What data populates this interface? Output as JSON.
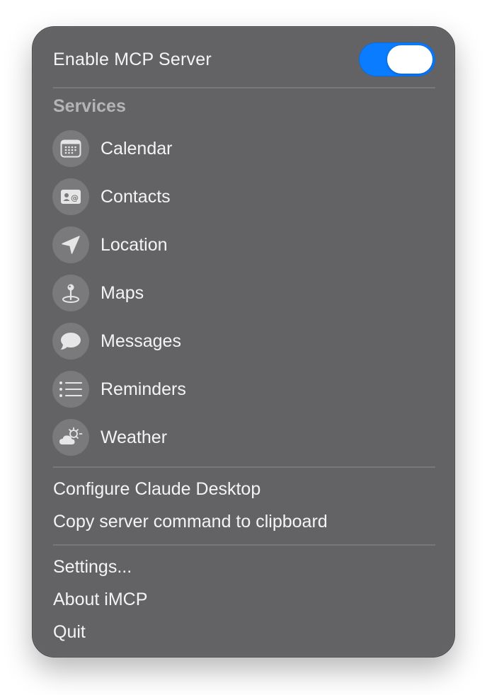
{
  "toggle": {
    "label": "Enable MCP Server",
    "enabled": true,
    "accent_color": "#0a7cff"
  },
  "services": {
    "header": "Services",
    "items": [
      {
        "label": "Calendar",
        "icon": "calendar-icon"
      },
      {
        "label": "Contacts",
        "icon": "contact-card-icon"
      },
      {
        "label": "Location",
        "icon": "location-arrow-icon"
      },
      {
        "label": "Maps",
        "icon": "map-pin-icon"
      },
      {
        "label": "Messages",
        "icon": "message-bubble-icon"
      },
      {
        "label": "Reminders",
        "icon": "list-icon"
      },
      {
        "label": "Weather",
        "icon": "cloud-sun-icon"
      }
    ]
  },
  "actions": {
    "configure": "Configure Claude Desktop",
    "copy_command": "Copy server command to clipboard",
    "settings": "Settings...",
    "about": "About iMCP",
    "quit": "Quit"
  }
}
